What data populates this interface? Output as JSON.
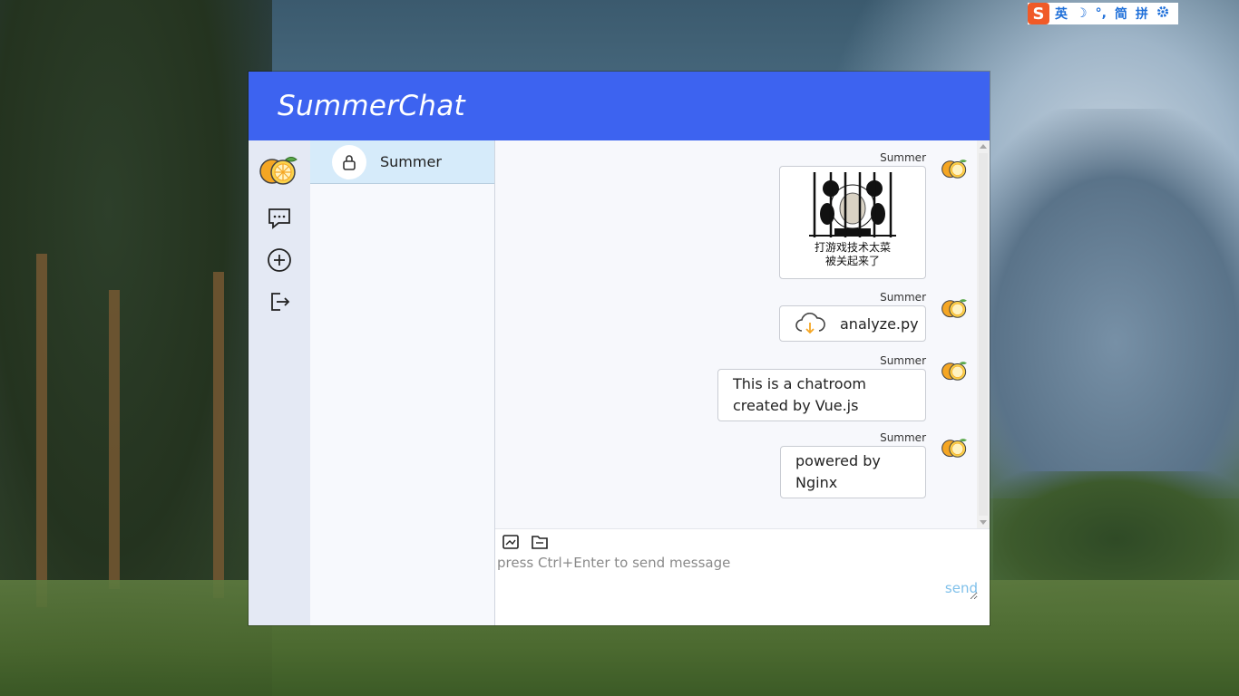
{
  "ime": {
    "logo": "S",
    "lang": "英",
    "moon": "☽",
    "punct": "°,",
    "simplified": "简",
    "pinyin": "拼",
    "settings_icon": "gear-icon"
  },
  "app": {
    "title": "SummerChat",
    "accent_color": "#3d63f0"
  },
  "rail": {
    "avatar_icon": "orange-avatar-icon",
    "tools": [
      {
        "name": "chat-bubble-icon"
      },
      {
        "name": "plus-circle-icon"
      },
      {
        "name": "logout-icon"
      }
    ]
  },
  "rooms": [
    {
      "name": "Summer",
      "icon": "lock-icon"
    }
  ],
  "messages": [
    {
      "sender": "Summer",
      "type": "image",
      "caption_line1": "打游戏技术太菜",
      "caption_line2": "被关起来了"
    },
    {
      "sender": "Summer",
      "type": "file",
      "filename": "analyze.py"
    },
    {
      "sender": "Summer",
      "type": "text",
      "line1": "This is a chatroom",
      "line2": "created by Vue.js"
    },
    {
      "sender": "Summer",
      "type": "text",
      "line1": "powered by",
      "line2": "Nginx"
    }
  ],
  "composer": {
    "placeholder": "press Ctrl+Enter to send message",
    "value": "",
    "send_label": "send"
  }
}
